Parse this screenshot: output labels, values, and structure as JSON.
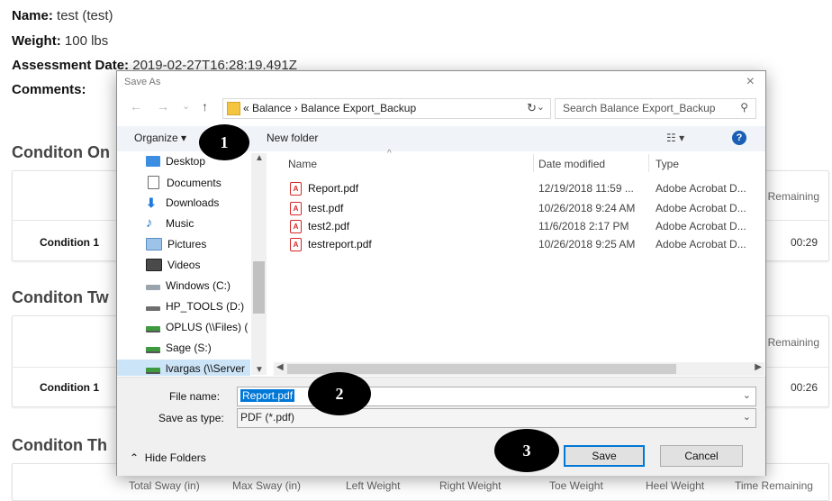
{
  "report": {
    "name_label": "Name:",
    "name_value": "test (test)",
    "weight_label": "Weight:",
    "weight_value": "100 lbs",
    "date_label": "Assessment Date:",
    "date_value": "2019-02-27T16:28:19.491Z",
    "comments_label": "Comments:",
    "sections": [
      {
        "title": "Conditon On",
        "remaining_header": "Remaining",
        "row_label": "Condition 1",
        "row_value": "00:29"
      },
      {
        "title": "Conditon Tw",
        "remaining_header": "Remaining",
        "row_label": "Condition 1",
        "row_value": "00:26"
      },
      {
        "title": "Conditon Th"
      }
    ],
    "column_headers": [
      "Total Sway (in)",
      "Max Sway (in)",
      "Left Weight",
      "Right Weight",
      "Toe Weight",
      "Heel Weight",
      "Time Remaining"
    ]
  },
  "dialog": {
    "title": "Save As",
    "close_glyph": "×",
    "back_glyph": "←",
    "forward_glyph": "→",
    "recent_glyph": "⌄",
    "up_glyph": "↑",
    "address": "«  Balance  ›  Balance Export_Backup",
    "address_dropdown_glyph": "⌄",
    "refresh_glyph": "↻",
    "search_placeholder": "Search Balance Export_Backup",
    "search_glyph": "⚲",
    "organize_label": "Organize ▾",
    "new_folder_label": "New folder",
    "view_glyph": "☷ ▾",
    "help_glyph": "?",
    "nav_items": [
      {
        "label": "Desktop",
        "icon": "desktop-icon"
      },
      {
        "label": "Documents",
        "icon": "documents-icon"
      },
      {
        "label": "Downloads",
        "icon": "downloads-icon"
      },
      {
        "label": "Music",
        "icon": "music-icon"
      },
      {
        "label": "Pictures",
        "icon": "pictures-icon"
      },
      {
        "label": "Videos",
        "icon": "videos-icon"
      },
      {
        "label": "Windows (C:)",
        "icon": "drive-icon"
      },
      {
        "label": "HP_TOOLS (D:)",
        "icon": "drive-icon"
      },
      {
        "label": "OPLUS (\\\\Files) (",
        "icon": "network-drive-icon"
      },
      {
        "label": "Sage (S:)",
        "icon": "network-drive-icon"
      },
      {
        "label": "lvargas (\\\\Server",
        "icon": "network-drive-icon"
      }
    ],
    "columns": {
      "name": "Name",
      "date": "Date modified",
      "type": "Type"
    },
    "files": [
      {
        "name": "Report.pdf",
        "date": "12/19/2018 11:59 ...",
        "type": "Adobe Acrobat D..."
      },
      {
        "name": "test.pdf",
        "date": "10/26/2018 9:24 AM",
        "type": "Adobe Acrobat D..."
      },
      {
        "name": "test2.pdf",
        "date": "11/6/2018 2:17 PM",
        "type": "Adobe Acrobat D..."
      },
      {
        "name": "testreport.pdf",
        "date": "10/26/2018 9:25 AM",
        "type": "Adobe Acrobat D..."
      }
    ],
    "file_name_label": "File name:",
    "file_name_value": "Report.pdf",
    "save_type_label": "Save as type:",
    "save_type_value": "PDF (*.pdf)",
    "hide_folders_label": "Hide Folders",
    "save_label": "Save",
    "cancel_label": "Cancel"
  },
  "markers": [
    "1",
    "2",
    "3"
  ],
  "colors": {
    "selection": "#0078d7",
    "nav_selected": "#cce4f7",
    "toolbar": "#f0f4f9",
    "marker": "#000000"
  }
}
